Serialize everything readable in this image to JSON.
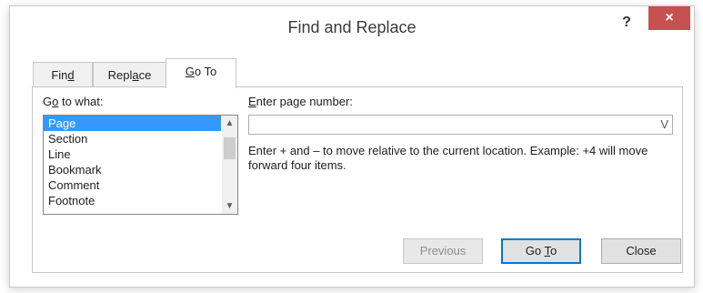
{
  "window": {
    "title": "Find and Replace",
    "help_label": "?",
    "close_label": "×"
  },
  "tabs": [
    {
      "label_pre": "Fin",
      "label_u": "d",
      "label_post": "",
      "active": false
    },
    {
      "label_pre": "Repl",
      "label_u": "a",
      "label_post": "ce",
      "active": false
    },
    {
      "label_pre": "",
      "label_u": "G",
      "label_post": "o To",
      "active": true
    }
  ],
  "goto": {
    "label_pre": "G",
    "label_u": "o",
    "label_post": " to what:",
    "items": [
      "Page",
      "Section",
      "Line",
      "Bookmark",
      "Comment",
      "Footnote"
    ],
    "selected": "Page"
  },
  "page_number": {
    "label_pre": "",
    "label_u": "E",
    "label_post": "nter page number:",
    "value": "",
    "arrow": "V"
  },
  "hint": "Enter + and – to move relative to the current location. Example: +4 will move forward four items.",
  "buttons": {
    "previous": "Previous",
    "goto_pre": "Go ",
    "goto_u": "T",
    "goto_post": "o",
    "close": "Close"
  },
  "colors": {
    "close_button": "#c75050",
    "selection": "#3399ff",
    "default_button_border": "#0078d7"
  }
}
